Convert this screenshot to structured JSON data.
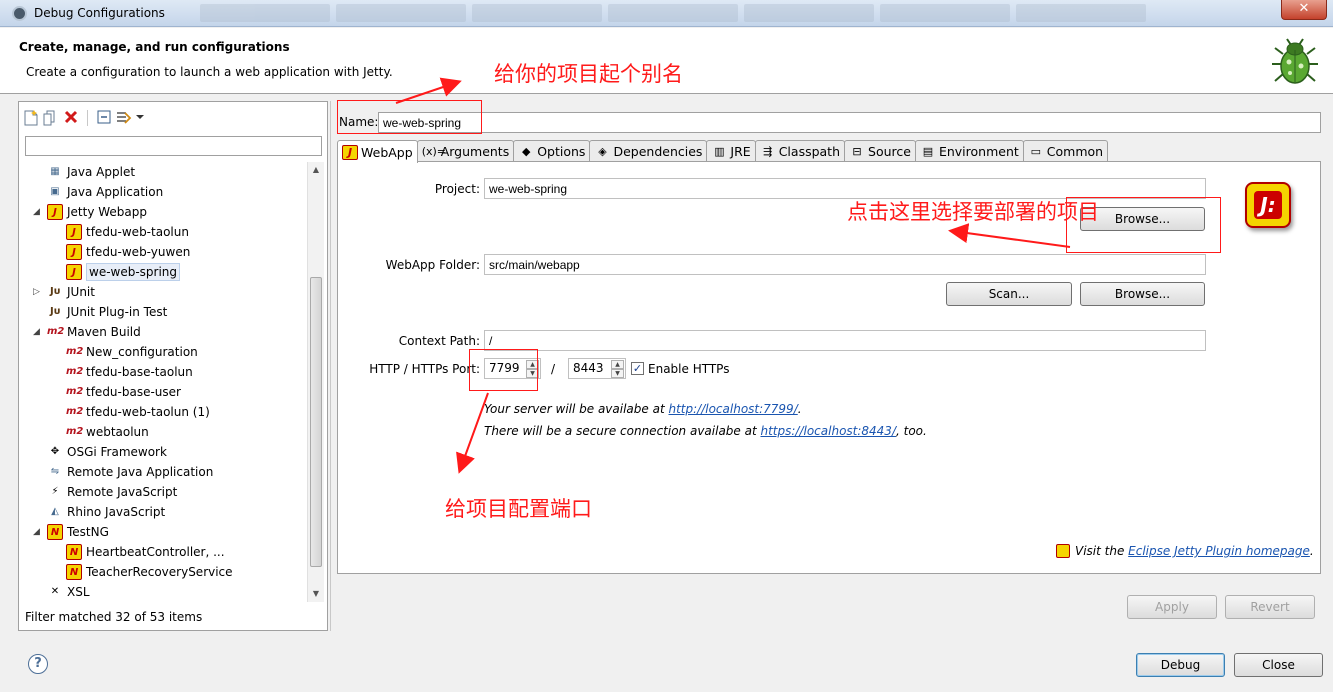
{
  "window": {
    "title": "Debug Configurations",
    "close_glyph": "✕"
  },
  "header": {
    "title": "Create, manage, and run configurations",
    "description": "Create a configuration to launch a web application with Jetty."
  },
  "left": {
    "filter_value": "",
    "toolbar_icons": [
      "new-config-icon",
      "duplicate-icon",
      "delete-icon",
      "collapse-all-icon",
      "filter-icon",
      "dropdown-arrow-icon"
    ],
    "tree": [
      {
        "label": "Java Applet",
        "level": 1,
        "icon": "java-applet-icon",
        "twisty": ""
      },
      {
        "label": "Java Application",
        "level": 1,
        "icon": "java-application-icon",
        "twisty": ""
      },
      {
        "label": "Jetty Webapp",
        "level": 1,
        "icon": "jetty-icon",
        "twisty": "◢"
      },
      {
        "label": "tfedu-web-taolun",
        "level": 2,
        "icon": "jetty-icon",
        "twisty": ""
      },
      {
        "label": "tfedu-web-yuwen",
        "level": 2,
        "icon": "jetty-icon",
        "twisty": ""
      },
      {
        "label": "we-web-spring",
        "level": 2,
        "icon": "jetty-icon",
        "twisty": "",
        "selected": true
      },
      {
        "label": "JUnit",
        "level": 1,
        "icon": "junit-icon",
        "twisty": "▷"
      },
      {
        "label": "JUnit Plug-in Test",
        "level": 1,
        "icon": "junit-plugin-icon",
        "twisty": ""
      },
      {
        "label": "Maven Build",
        "level": 1,
        "icon": "maven-icon",
        "twisty": "◢"
      },
      {
        "label": "New_configuration",
        "level": 2,
        "icon": "maven-icon",
        "twisty": ""
      },
      {
        "label": "tfedu-base-taolun",
        "level": 2,
        "icon": "maven-icon",
        "twisty": ""
      },
      {
        "label": "tfedu-base-user",
        "level": 2,
        "icon": "maven-icon",
        "twisty": ""
      },
      {
        "label": "tfedu-web-taolun (1)",
        "level": 2,
        "icon": "maven-icon",
        "twisty": ""
      },
      {
        "label": "webtaolun",
        "level": 2,
        "icon": "maven-icon",
        "twisty": ""
      },
      {
        "label": "OSGi Framework",
        "level": 1,
        "icon": "osgi-icon",
        "twisty": ""
      },
      {
        "label": "Remote Java Application",
        "level": 1,
        "icon": "remote-java-icon",
        "twisty": ""
      },
      {
        "label": "Remote JavaScript",
        "level": 1,
        "icon": "remote-js-icon",
        "twisty": ""
      },
      {
        "label": "Rhino JavaScript",
        "level": 1,
        "icon": "rhino-icon",
        "twisty": ""
      },
      {
        "label": "TestNG",
        "level": 1,
        "icon": "testng-icon",
        "twisty": "◢"
      },
      {
        "label": "HeartbeatController, ...",
        "level": 2,
        "icon": "testng-icon",
        "twisty": ""
      },
      {
        "label": "TeacherRecoveryService",
        "level": 2,
        "icon": "testng-icon",
        "twisty": ""
      },
      {
        "label": "XSL",
        "level": 1,
        "icon": "xsl-icon",
        "twisty": ""
      }
    ],
    "status": "Filter matched 32 of 53 items"
  },
  "right": {
    "name_label": "Name:",
    "name_value": "we-web-spring",
    "tabs": [
      {
        "label": "WebApp",
        "icon": "jetty-icon",
        "active": true
      },
      {
        "label": "Arguments",
        "icon": "arguments-icon"
      },
      {
        "label": "Options",
        "icon": "options-icon"
      },
      {
        "label": "Dependencies",
        "icon": "dependencies-icon"
      },
      {
        "label": "JRE",
        "icon": "jre-icon"
      },
      {
        "label": "Classpath",
        "icon": "classpath-icon"
      },
      {
        "label": "Source",
        "icon": "source-icon"
      },
      {
        "label": "Environment",
        "icon": "environment-icon"
      },
      {
        "label": "Common",
        "icon": "common-icon"
      }
    ],
    "project_label": "Project:",
    "project_value": "we-web-spring",
    "browse_label": "Browse...",
    "webapp_folder_label": "WebApp Folder:",
    "webapp_folder_value": "src/main/webapp",
    "scan_label": "Scan...",
    "browse2_label": "Browse...",
    "context_path_label": "Context Path:",
    "context_path_value": "/",
    "port_label": "HTTP / HTTPs Port:",
    "http_port": "7799",
    "port_separator": "/",
    "https_port": "8443",
    "enable_https_label": "Enable HTTPs",
    "enable_https_checked": true,
    "info_line1_prefix": "Your server will be availabe at ",
    "info_line1_link": "http://localhost:7799/",
    "info_line1_suffix": ".",
    "info_line2_prefix": "There will be a secure connection availabe at ",
    "info_line2_link": "https://localhost:8443/",
    "info_line2_suffix": ", too.",
    "visit_prefix": "Visit the ",
    "visit_link": "Eclipse Jetty Plugin homepage",
    "visit_suffix": ".",
    "apply_label": "Apply",
    "revert_label": "Revert"
  },
  "footer": {
    "help_glyph": "?",
    "debug_label": "Debug",
    "close_label": "Close"
  },
  "annotations": {
    "alias": "给你的项目起个别名",
    "select_project": "点击这里选择要部署的项目",
    "port": "给项目配置端口",
    "color": "#ff1a1a"
  }
}
